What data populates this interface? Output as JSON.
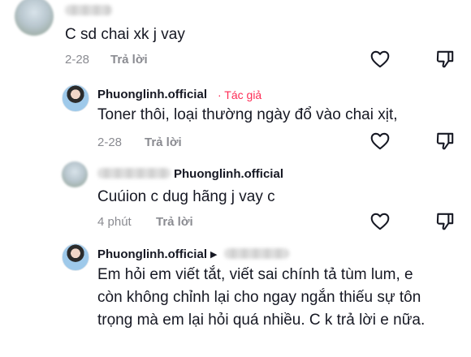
{
  "comments": [
    {
      "username_blurred": true,
      "text": "C sd chai xk j vay",
      "date": "2-28",
      "reply_label": "Trả lời"
    },
    {
      "username": "Phuonglinh.official",
      "author_badge": "· Tác giả",
      "text": "Toner thôi, loại thường ngày đổ vào chai xịt,",
      "date": "2-28",
      "reply_label": "Trả lời"
    },
    {
      "username_blurred": true,
      "reply_to": "Phuonglinh.official",
      "text": "Cuúion c dug hãng j vay c",
      "date": "4 phút",
      "reply_label": "Trả lời"
    },
    {
      "username": "Phuonglinh.official",
      "reply_to_blurred": true,
      "text": "Em hỏi em viết tắt, viết sai chính tả tùm lum, e còn không chỉnh lại cho ngay ngắn thiếu sự tôn trọng mà em lại hỏi quá nhiều. C k trả lời e nữa."
    }
  ],
  "icons": {
    "like": "heart-outline-icon",
    "dislike": "thumbs-down-icon",
    "reply_arrow": "triangle-right-icon"
  }
}
